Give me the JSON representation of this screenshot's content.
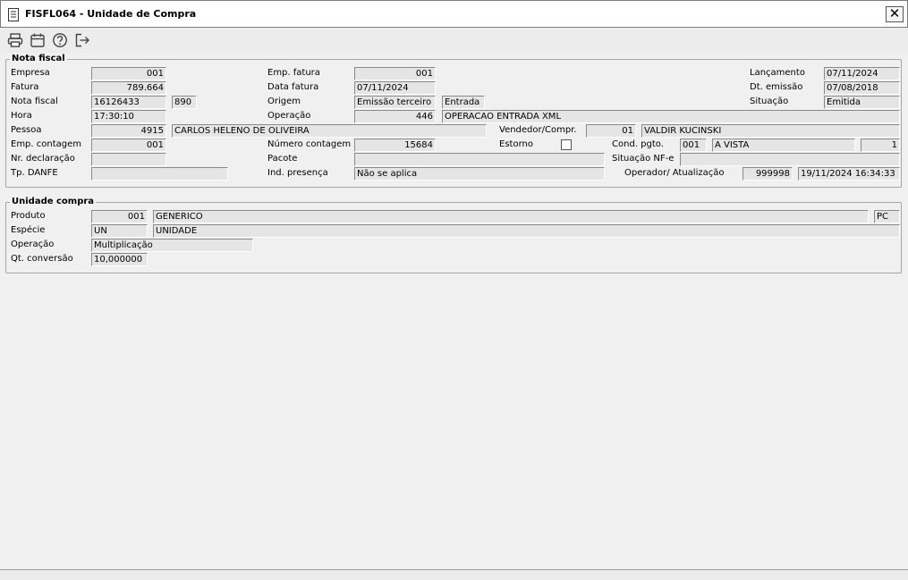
{
  "window": {
    "title": "FISFL064 - Unidade de Compra",
    "close_label": "✕"
  },
  "toolbar": {
    "buttons": [
      {
        "icon": "printer-icon"
      },
      {
        "icon": "calendar-icon"
      },
      {
        "icon": "help-icon"
      },
      {
        "icon": "exit-icon"
      }
    ]
  },
  "nota": {
    "legend": "Nota fiscal",
    "labels": {
      "empresa": "Empresa",
      "fatura": "Fatura",
      "nota_fiscal": "Nota fiscal",
      "hora": "Hora",
      "pessoa": "Pessoa",
      "emp_contagem": "Emp. contagem",
      "nr_declaracao": "Nr. declaração",
      "tp_danfe": "Tp. DANFE",
      "emp_fatura": "Emp. fatura",
      "data_fatura": "Data fatura",
      "origem": "Origem",
      "operacao": "Operação",
      "numero_contagem": "Número contagem",
      "pacote": "Pacote",
      "ind_presenca": "Ind. presença",
      "lancamento": "Lançamento",
      "dt_emissao": "Dt. emissão",
      "situacao": "Situação",
      "vendedor": "Vendedor/Compr.",
      "estorno": "Estorno",
      "cond_pgto": "Cond. pgto.",
      "situacao_nfe": "Situação NF-e",
      "operador": "Operador/ Atualização"
    },
    "values": {
      "empresa": "001",
      "fatura": "789.664",
      "nota_fiscal": "16126433",
      "nota_serie": "890",
      "hora": "17:30:10",
      "pessoa_cod": "4915",
      "pessoa_nome": "CARLOS HELENO DE OLIVEIRA",
      "emp_contagem": "001",
      "nr_declaracao": "",
      "tp_danfe": "",
      "emp_fatura": "001",
      "data_fatura": "07/11/2024",
      "origem": "Emissão terceiro",
      "origem_tipo": "Entrada",
      "operacao_cod": "446",
      "operacao_desc": "OPERACAO ENTRADA XML",
      "numero_contagem": "15684",
      "pacote": "",
      "ind_presenca": "Não se aplica",
      "lancamento": "07/11/2024",
      "dt_emissao": "07/08/2018",
      "situacao": "Emitida",
      "vendedor_cod": "01",
      "vendedor_nome": "VALDIR KUCINSKI",
      "cond_pgto_cod": "001",
      "cond_pgto_desc": "A VISTA",
      "cond_pgto_parc": "1",
      "situacao_nfe": "",
      "operador_cod": "999998",
      "operador_data": "19/11/2024 16:34:33"
    }
  },
  "unidade": {
    "legend": "Unidade compra",
    "labels": {
      "produto": "Produto",
      "especie": "Espécie",
      "operacao": "Operação",
      "qt_conversao": "Qt. conversão"
    },
    "values": {
      "produto_cod": "001",
      "produto_nome": "GENERICO",
      "produto_un": "PC",
      "especie_cod": "UN",
      "especie_nome": "UNIDADE",
      "operacao": "Multiplicação",
      "qt_conversao": "10,000000"
    }
  }
}
